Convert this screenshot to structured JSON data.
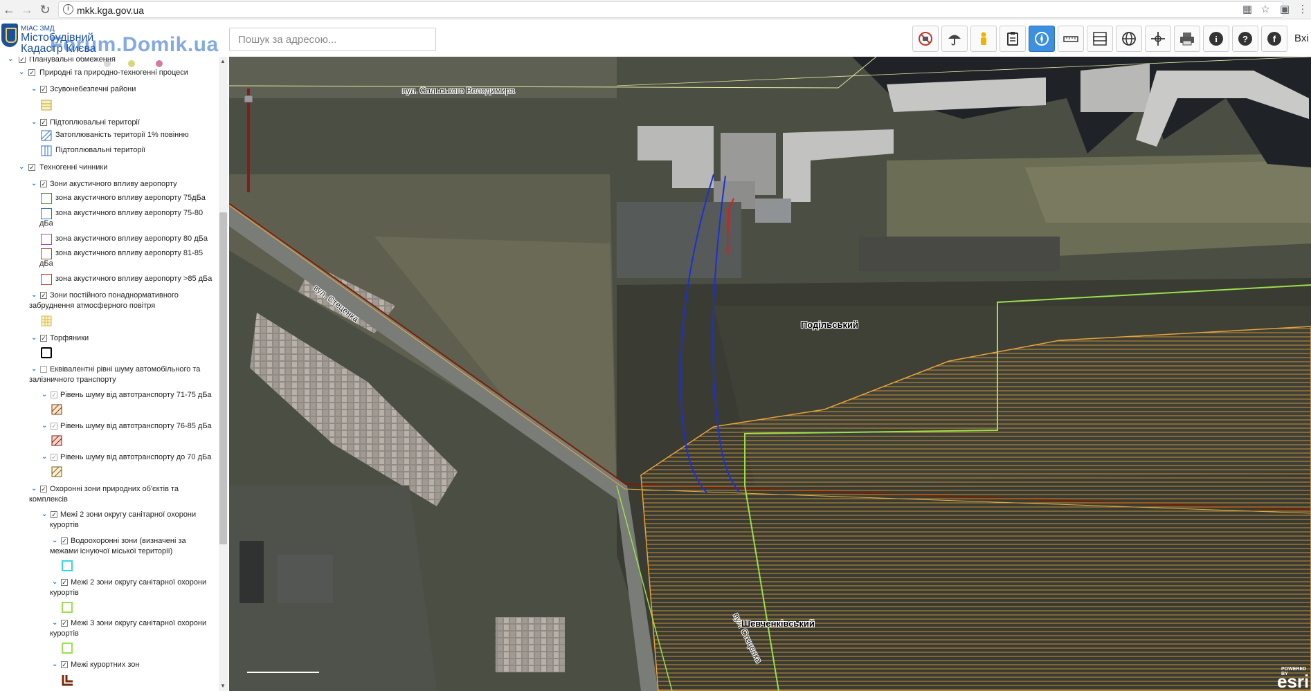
{
  "browser": {
    "url": "mkk.kga.gov.ua",
    "back_icon": "back-arrow-icon",
    "forward_icon": "forward-arrow-icon",
    "reload_icon": "reload-icon"
  },
  "header": {
    "logo_top": "МІАС ЗМД",
    "logo_line1": "Містобудівний",
    "logo_line2": "Кадастр Києва",
    "watermark": "Forum.Domik.ua",
    "search_placeholder": "Пошук за адресою...",
    "login_label": "Вхі",
    "tools": [
      "no-layers-icon",
      "umbrella-icon",
      "person-icon",
      "clipboard-icon",
      "compass-icon",
      "ruler-icon",
      "ruler-area-icon",
      "globe-icon",
      "pan-icon",
      "print-icon",
      "info-icon",
      "help-icon",
      "facebook-icon"
    ],
    "active_tool": "compass-icon"
  },
  "sidebar": {
    "items": [
      {
        "label": "Планувальні обмеження"
      },
      {
        "label": "Природні та природно-техногенні процеси"
      },
      {
        "label": "Зсувонебезпечні райони"
      },
      {
        "label": "Підтоплювальні території"
      },
      {
        "label": "Затоплюваність території 1% повінню"
      },
      {
        "label": "Підтоплювальні території"
      },
      {
        "label": "Техногенні чинники"
      },
      {
        "label": "Зони акустичного впливу аеропорту"
      },
      {
        "label": "зона акустичного впливу аеропорту 75дБа"
      },
      {
        "label": "зона акустичного впливу аеропорту 75-80"
      },
      {
        "label": "дБа"
      },
      {
        "label": "зона акустичного впливу аеропорту 80 дБа"
      },
      {
        "label": "зона акустичного впливу аеропорту 81-85"
      },
      {
        "label": "дБа"
      },
      {
        "label": "зона акустичного впливу аеропорту >85 дБа"
      },
      {
        "label": "Зони постійного понаднормативного"
      },
      {
        "label": "забруднення атмосферного повітря"
      },
      {
        "label": "Торфяники"
      },
      {
        "label": "Еквівалентні рівні шуму автомобільного та"
      },
      {
        "label": "залізничного транспорту"
      },
      {
        "label": "Рівень шуму від автотранспорту 71-75 дБа"
      },
      {
        "label": "Рівень шуму від автотранспорту 76-85 дБа"
      },
      {
        "label": "Рівень шуму від автотранспорту до 70 дБа"
      },
      {
        "label": "Охоронні зони природних об'єктів та"
      },
      {
        "label": "комплексів"
      },
      {
        "label": "Межі 2 зони округу санітарної охорони"
      },
      {
        "label": "курортів"
      },
      {
        "label": "Водоохоронні зони (визначені за"
      },
      {
        "label": "межами існуючої міської території)"
      },
      {
        "label": "Межі 2 зони округу санітарної охорони"
      },
      {
        "label": "курортів"
      },
      {
        "label": "Межі 3 зони округу санітарної охорони"
      },
      {
        "label": "курортів"
      },
      {
        "label": "Межі курортних зон"
      }
    ]
  },
  "map": {
    "labels": {
      "district_podilskyi": "Подільський",
      "district_shevchenkivskyi": "Шевченківський",
      "street_salskoho": "вул. Сальського Володимира",
      "street_stetsenka": "вул. Стеценка",
      "street_sverstiuka": "вул. Стеценка"
    },
    "esri_powered": "POWERED BY",
    "esri_logo": "esri"
  },
  "colors": {
    "accent": "#3d8fe0",
    "zone_boundary": "#9be04a",
    "route_blue": "#1b2fd6",
    "route_red": "#e01a1a",
    "orange_hatch": "#e8a33a"
  }
}
